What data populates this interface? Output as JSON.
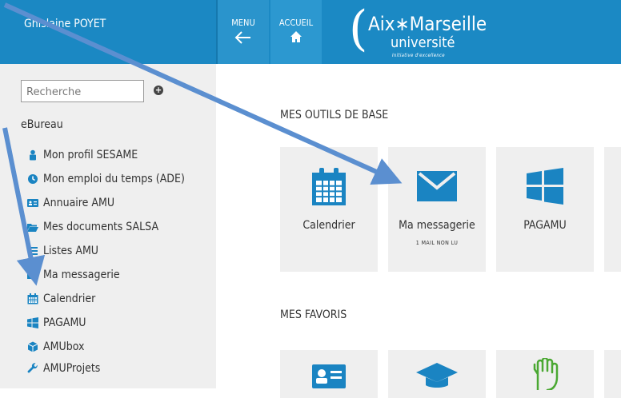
{
  "header": {
    "user_name": "Ghislaine POYET",
    "menu_label": "MENU",
    "home_label": "ACCUEIL",
    "brand_name": "Aix∗Marseille",
    "brand_sub": "université",
    "brand_tagline": "Initiative d'excellence"
  },
  "sidebar": {
    "search_placeholder": "Recherche",
    "section": "eBureau",
    "items": [
      {
        "label": "Mon profil SESAME",
        "icon": "user-lock-icon"
      },
      {
        "label": "Mon emploi du temps (ADE)",
        "icon": "clock-icon"
      },
      {
        "label": "Annuaire AMU",
        "icon": "id-card-icon"
      },
      {
        "label": "Mes documents SALSA",
        "icon": "folder-open-icon"
      },
      {
        "label": "Listes AMU",
        "icon": "list-icon"
      },
      {
        "label": "Ma messagerie",
        "icon": "envelope-icon"
      },
      {
        "label": "Calendrier",
        "icon": "calendar-icon"
      },
      {
        "label": "PAGAMU",
        "icon": "windows-icon"
      },
      {
        "label": "AMUbox",
        "icon": "box-icon"
      },
      {
        "label": "AMUProjets",
        "icon": "wrench-icon"
      }
    ]
  },
  "main": {
    "base_tools_title": "MES OUTILS DE BASE",
    "favorites_title": "MES FAVORIS",
    "tiles": [
      {
        "label": "Calendrier",
        "icon": "calendar-icon"
      },
      {
        "label": "Ma messagerie",
        "sub": "1 MAIL NON LU",
        "icon": "envelope-icon"
      },
      {
        "label": "PAGAMU",
        "icon": "windows-icon"
      }
    ],
    "favorite_icons": [
      "id-card-icon",
      "graduation-cap-icon",
      "hand-icon"
    ]
  },
  "colors": {
    "header_blue": "#1b89c4",
    "icon_blue": "#1a84c2",
    "arrow_blue": "#5b8fd0",
    "sidebar_bg": "#efefef",
    "tile_bg": "#efefef"
  }
}
